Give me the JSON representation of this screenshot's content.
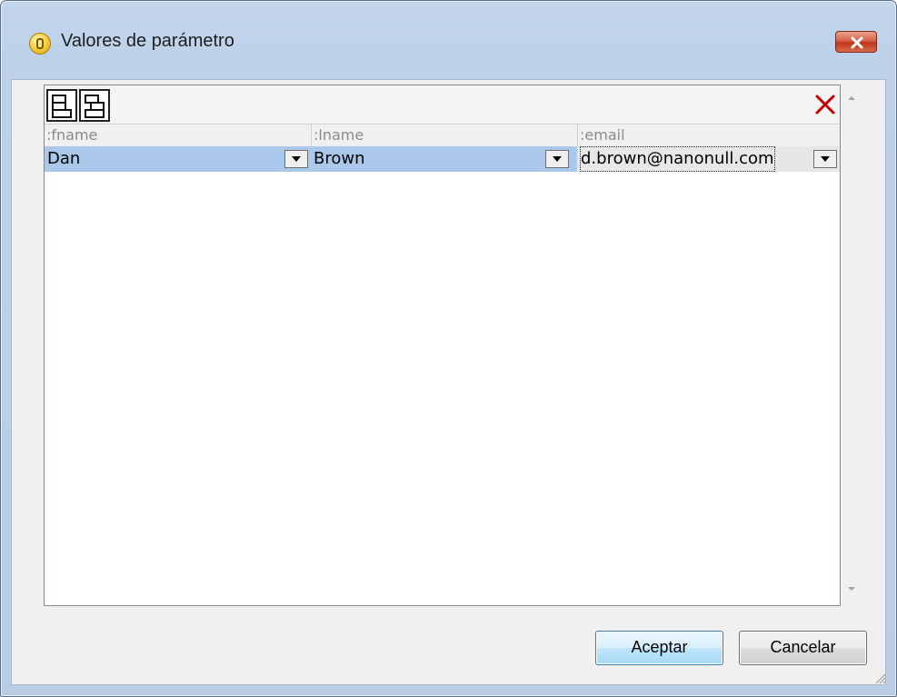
{
  "window": {
    "title": "Valores de parámetro"
  },
  "grid": {
    "columns": [
      ":fname",
      ":lname",
      ":email"
    ],
    "rows": [
      [
        "Dan",
        "Brown",
        "d.brown@nanonull.com"
      ]
    ]
  },
  "buttons": {
    "ok": "Aceptar",
    "cancel": "Cancelar"
  },
  "colors": {
    "selection": "#a9c8ea",
    "close": "#c0351c",
    "delete_icon": "#c00000"
  }
}
